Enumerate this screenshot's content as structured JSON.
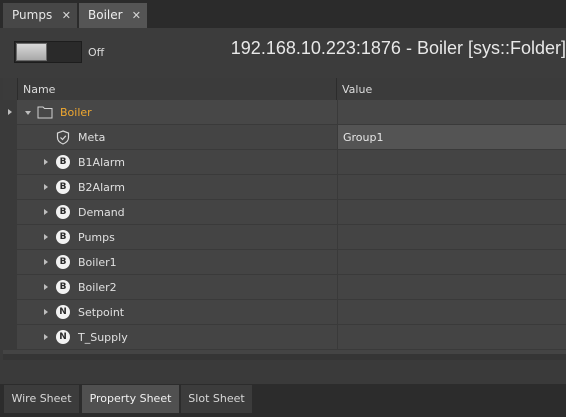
{
  "tabs": [
    {
      "label": "Pumps",
      "close": "✕"
    },
    {
      "label": "Boiler",
      "close": "✕"
    }
  ],
  "header": {
    "toggle_label": "Off",
    "toggle_state": "off",
    "title": "192.168.10.223:1876 - Boiler [sys::Folder]"
  },
  "table": {
    "columns": {
      "name": "Name",
      "value": "Value"
    },
    "root": {
      "label": "Boiler",
      "value": "",
      "color": "#f0a830"
    },
    "meta": {
      "label": "Meta",
      "value": "Group1"
    },
    "items": [
      {
        "badge": "B",
        "label": "B1Alarm",
        "value": ""
      },
      {
        "badge": "B",
        "label": "B2Alarm",
        "value": ""
      },
      {
        "badge": "B",
        "label": "Demand",
        "value": ""
      },
      {
        "badge": "B",
        "label": "Pumps",
        "value": ""
      },
      {
        "badge": "B",
        "label": "Boiler1",
        "value": ""
      },
      {
        "badge": "B",
        "label": "Boiler2",
        "value": ""
      },
      {
        "badge": "N",
        "label": "Setpoint",
        "value": ""
      },
      {
        "badge": "N",
        "label": "T_Supply",
        "value": ""
      }
    ]
  },
  "bottom_tabs": [
    {
      "label": "Wire Sheet",
      "active": false
    },
    {
      "label": "Property Sheet",
      "active": true
    },
    {
      "label": "Slot Sheet",
      "active": false
    }
  ],
  "icons": {
    "folder": "folder-icon",
    "meta": "shield-icon",
    "boolean": "b-badge-icon",
    "numeric": "n-badge-icon"
  }
}
